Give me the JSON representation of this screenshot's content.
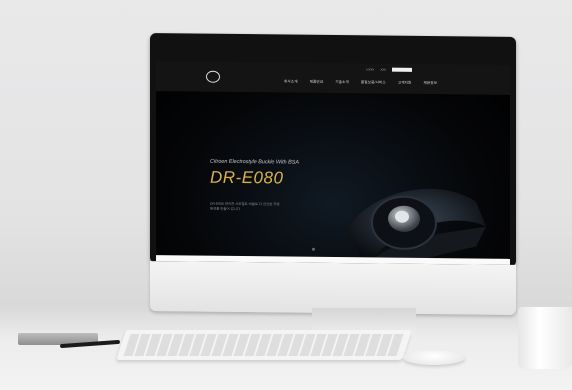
{
  "site": {
    "nav_items": [
      "회사소개",
      "제품안내",
      "기술소개",
      "품질보증/서비스",
      "고객지원",
      "채용정보"
    ],
    "util_links": [
      "LOGIN",
      "JOIN"
    ],
    "hero_subtitle": "Citroen Electrostyle Buckle With BSA",
    "hero_title": "DR-E080",
    "hero_description": "DR-E080 편리한 시트벨트 버클로 더 안전한 주행 환경을 만들어 갑니다"
  },
  "colors": {
    "hero_title": "#d9b34a",
    "screen_bg": "#050608",
    "nav_bg": "#141414"
  },
  "icons": {
    "logo": "circle-logo-icon",
    "search": "search-icon"
  }
}
